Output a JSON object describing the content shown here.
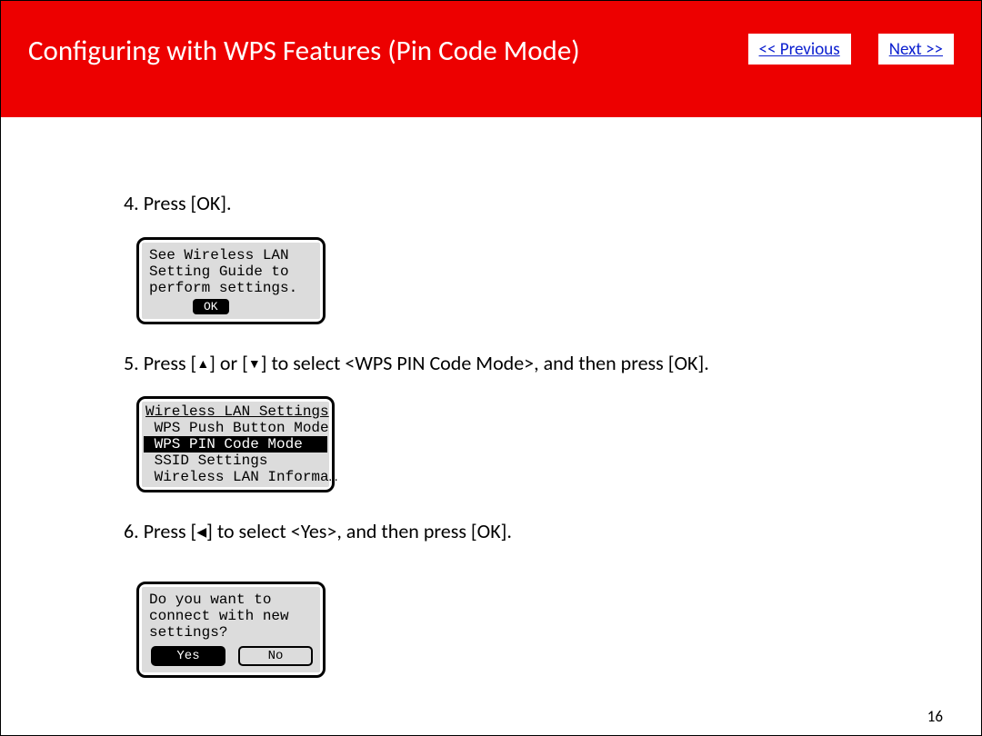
{
  "header": {
    "title": "Configuring with WPS Features (Pin Code Mode)",
    "prev_label": "<< Previous",
    "next_label": "Next >>"
  },
  "steps": {
    "s4": {
      "prefix": "4. ",
      "text": "Press [OK]."
    },
    "s5": {
      "prefix": "5. ",
      "pre": "Press [",
      "mid": "] or [",
      "post": "] to select <WPS PIN Code Mode>, and then press [OK]."
    },
    "s6": {
      "prefix": "6. ",
      "pre": "Press [",
      "post": "] to select <Yes>, and then press [OK]."
    }
  },
  "arrows": {
    "up": "▲",
    "down": "▼",
    "left": "◀"
  },
  "lcd1": {
    "line1": "See Wireless LAN",
    "line2": "Setting Guide to",
    "line3": "perform settings.",
    "ok": "OK"
  },
  "lcd2": {
    "title": "Wireless LAN Settings",
    "opt1": " WPS Push Button Mode",
    "opt2": " WPS PIN Code Mode   ",
    "opt3": " SSID Settings",
    "opt4": " Wireless LAN Informa…"
  },
  "lcd3": {
    "line1": "Do you want to",
    "line2": "connect with new",
    "line3": "settings?",
    "yes": "Yes",
    "no": "No"
  },
  "page_number": "16"
}
